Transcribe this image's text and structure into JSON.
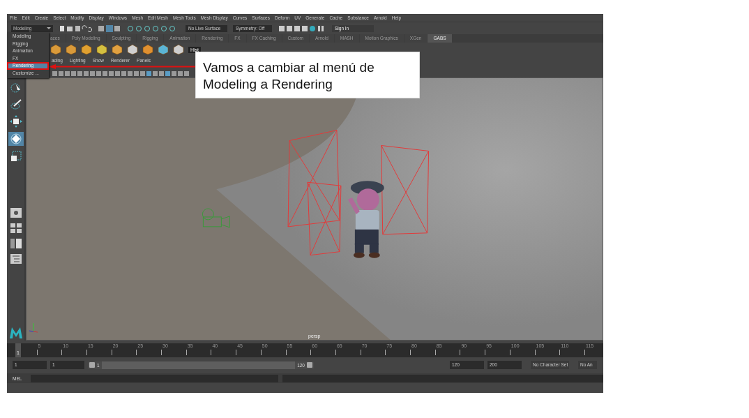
{
  "menu_bar": [
    "File",
    "Edit",
    "Create",
    "Select",
    "Modify",
    "Display",
    "Windows",
    "Mesh",
    "Edit Mesh",
    "Mesh Tools",
    "Mesh Display",
    "Curves",
    "Surfaces",
    "Deform",
    "UV",
    "Generate",
    "Cache",
    "Substance",
    "Arnold",
    "Help"
  ],
  "status_line": {
    "mode_dropdown": "Modeling",
    "live_surface": "No Live Surface",
    "symmetry": "Symmetry: Off",
    "sign_in": "Sign In"
  },
  "shelf_tabs": [
    {
      "label": "aces",
      "selected": false
    },
    {
      "label": "Poly Modeling",
      "selected": false
    },
    {
      "label": "Sculpting",
      "selected": false
    },
    {
      "label": "Rigging",
      "selected": false
    },
    {
      "label": "Animation",
      "selected": false
    },
    {
      "label": "Rendering",
      "selected": false
    },
    {
      "label": "FX",
      "selected": false
    },
    {
      "label": "FX Caching",
      "selected": false
    },
    {
      "label": "Custom",
      "selected": false
    },
    {
      "label": "Arnold",
      "selected": false
    },
    {
      "label": "MASH",
      "selected": false
    },
    {
      "label": "Motion Graphics",
      "selected": false
    },
    {
      "label": "XGen",
      "selected": false
    },
    {
      "label": "GABS",
      "selected": true
    }
  ],
  "shelf": {
    "history_badge": "Hist"
  },
  "mode_menu": [
    {
      "label": "Modeling",
      "selected": false
    },
    {
      "label": "Rigging",
      "selected": false
    },
    {
      "label": "Animation",
      "selected": false
    },
    {
      "label": "FX",
      "selected": false
    },
    {
      "label": "Rendering",
      "selected": true
    },
    {
      "label": "Customize ...",
      "selected": false
    }
  ],
  "panel_menu": [
    "ading",
    "Lighting",
    "Show",
    "Renderer",
    "Panels"
  ],
  "viewport": {
    "camera_label": "persp"
  },
  "timeline": {
    "current_frame": "1",
    "level": 0,
    "ticks": [
      "5",
      "10",
      "15",
      "20",
      "25",
      "30",
      "35",
      "40",
      "45",
      "50",
      "55",
      "60",
      "65",
      "70",
      "75",
      "80",
      "85",
      "90",
      "95",
      "100",
      "105",
      "110",
      "115"
    ]
  },
  "range_slider": {
    "level": 1,
    "start": "1",
    "playback_start": "1",
    "slider_start": "1",
    "slider_end": "120",
    "playback_end": "120",
    "end": "200",
    "character_set": "No Character Set",
    "anim_layer": "No An"
  },
  "command_line": {
    "language": "MEL"
  },
  "callout": {
    "text": "Vamos a cambiar al menú de Modeling a Rendering"
  }
}
